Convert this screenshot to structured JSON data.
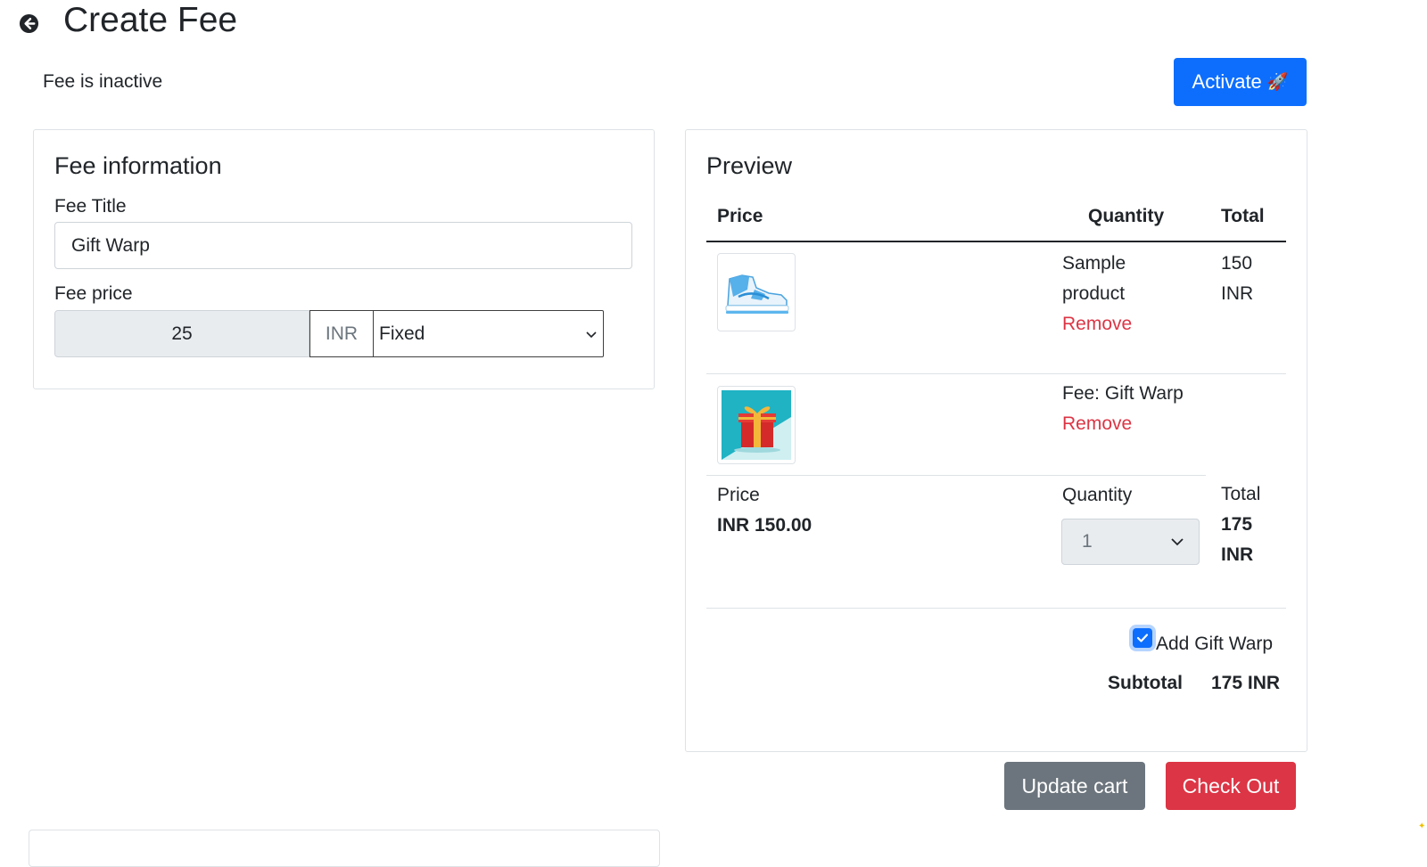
{
  "header": {
    "title": "Create Fee",
    "back_icon": "arrow-circle-left-icon"
  },
  "status": {
    "text": "Fee is inactive",
    "activate_label": "Activate",
    "activate_emoji": "🚀",
    "activate_color": "#0d6efd"
  },
  "fee_info": {
    "title": "Fee information",
    "fee_title_label": "Fee Title",
    "fee_title_value": "Gift Warp",
    "fee_price_label": "Fee price",
    "fee_price_value": "25",
    "currency": "INR",
    "type_value": "Fixed"
  },
  "preview": {
    "title": "Preview",
    "columns": {
      "price": "Price",
      "quantity": "Quantity",
      "total": "Total"
    },
    "rows": [
      {
        "image_icon": "sneaker-icon",
        "name_line1": "Sample",
        "name_line2": "product",
        "remove": "Remove",
        "total_line1": "150",
        "total_line2": "INR"
      },
      {
        "image_icon": "gift-box-icon",
        "name": "Fee: Gift Warp",
        "remove": "Remove"
      }
    ],
    "summary": {
      "price_label": "Price",
      "price_value": "INR 150.00",
      "quantity_label": "Quantity",
      "quantity_value": "1",
      "total_label": "Total",
      "total_line1": "175",
      "total_line2": "INR"
    },
    "gift_checkbox_label": "Add Gift Warp",
    "gift_checked": true,
    "subtotal_label": "Subtotal",
    "subtotal_value": "175 INR"
  },
  "actions": {
    "update_cart": "Update cart",
    "check_out": "Check Out",
    "update_color": "#6c757d",
    "checkout_color": "#dc3545"
  }
}
